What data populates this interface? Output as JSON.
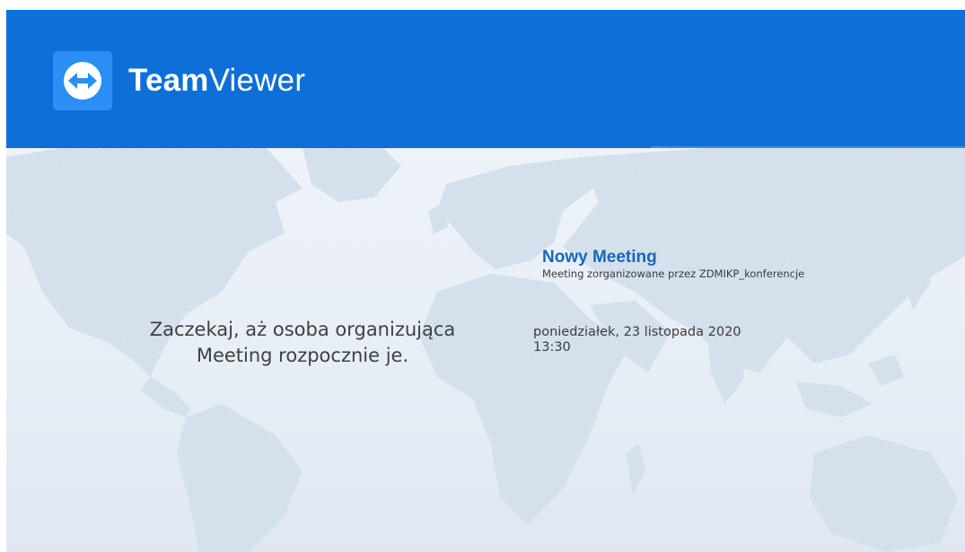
{
  "app": {
    "logo_icon": "teamviewer-arrows-icon",
    "brand_bold": "Team",
    "brand_light": "Viewer"
  },
  "waiting": {
    "line1": "Zaczekaj, aż osoba organizująca",
    "line2": "Meeting rozpocznie je."
  },
  "meeting": {
    "title": "Nowy Meeting",
    "organizer": "Meeting zorganizowane przez ZDMIKP_konferencje",
    "date": "poniedziałek, 23 listopada 2020",
    "time": "13:30"
  },
  "colors": {
    "header": "#0e6fd8",
    "logo_box": "#2a8ef2",
    "title": "#1a66b8",
    "background": "#e9f0f7",
    "map_land": "#d3dfeb"
  }
}
